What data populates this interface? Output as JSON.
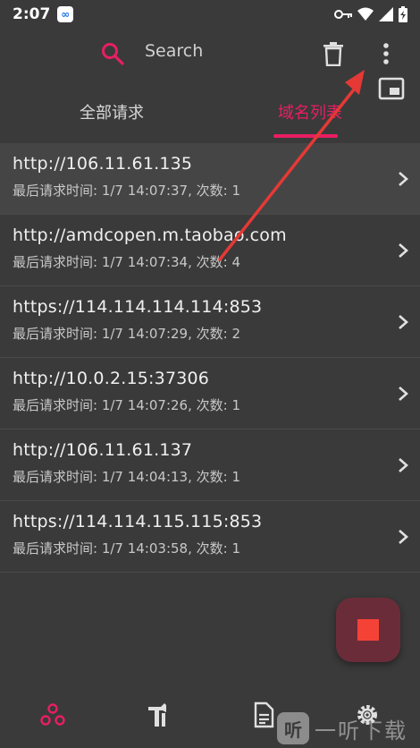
{
  "status_bar": {
    "time": "2:07",
    "app_badge": "∞"
  },
  "toolbar": {
    "search_label": "Search"
  },
  "tabs": [
    {
      "label": "全部请求",
      "active": false
    },
    {
      "label": "域名列表",
      "active": true
    }
  ],
  "list": [
    {
      "host": "http://106.11.61.135",
      "detail": "最后请求时间: 1/7 14:07:37,  次数: 1"
    },
    {
      "host": "http://amdcopen.m.taobao.com",
      "detail": "最后请求时间: 1/7 14:07:34,  次数: 4"
    },
    {
      "host": "https://114.114.114.114:853",
      "detail": "最后请求时间: 1/7 14:07:29,  次数: 2"
    },
    {
      "host": "http://10.0.2.15:37306",
      "detail": "最后请求时间: 1/7 14:07:26,  次数: 1"
    },
    {
      "host": "http://106.11.61.137",
      "detail": "最后请求时间: 1/7 14:04:13,  次数: 1"
    },
    {
      "host": "https://114.114.115.115:853",
      "detail": "最后请求时间: 1/7 14:03:58,  次数: 1"
    }
  ],
  "watermark": {
    "badge": "听",
    "text": "一听下载"
  },
  "colors": {
    "accent": "#e91e63",
    "background": "#3a3a3a",
    "fab": "#6b2c3a",
    "stop": "#f44336",
    "annotation_arrow": "#e53935"
  },
  "icons": {
    "search": "search-icon",
    "delete": "trash-icon",
    "more": "more-vert-icon",
    "pip": "picture-in-picture-icon",
    "chevron": "chevron-right-icon",
    "nav": [
      "network-icon",
      "tools-icon",
      "document-icon",
      "settings-icon"
    ]
  }
}
